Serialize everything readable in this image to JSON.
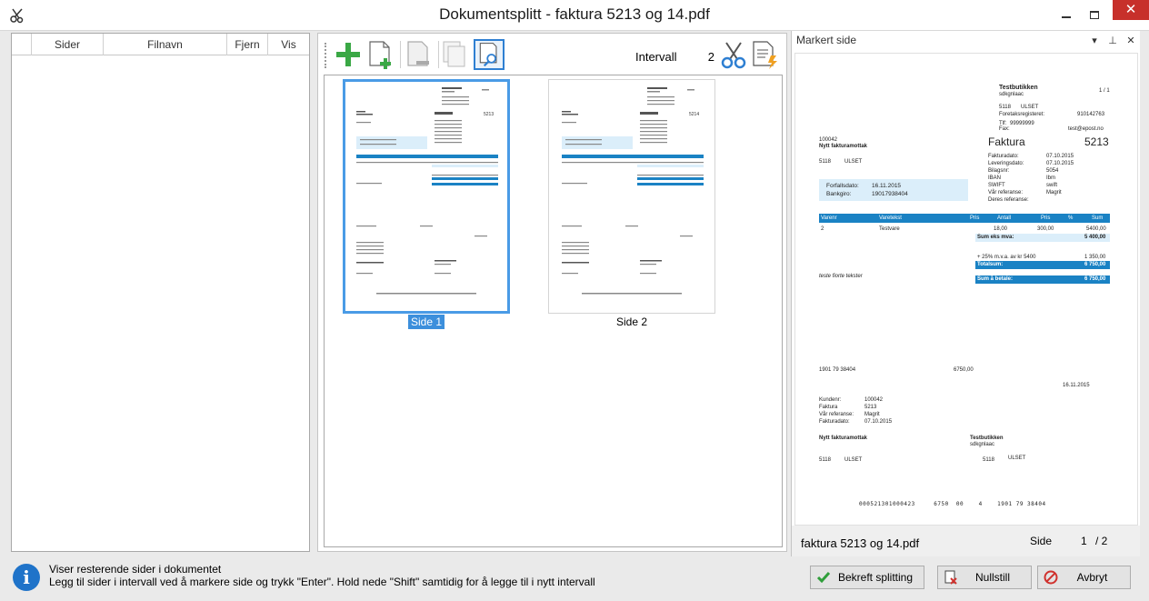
{
  "window": {
    "title": "Dokumentsplitt - faktura 5213 og 14.pdf",
    "minimize": "–",
    "maximize": "□",
    "close": "✕"
  },
  "list": {
    "columns": [
      "",
      "Sider",
      "Filnavn",
      "Fjern",
      "Vis"
    ]
  },
  "toolbar": {
    "interval_label": "Intervall",
    "interval_value": "2"
  },
  "thumbnails": [
    {
      "label": "Side 1",
      "selected": true,
      "invoice_no": "5213"
    },
    {
      "label": "Side 2",
      "selected": false,
      "invoice_no": "5214"
    }
  ],
  "preview": {
    "panel_title": "Markert side",
    "filename": "faktura 5213 og 14.pdf",
    "page_label": "Side",
    "page_current": "1",
    "page_total": "/ 2",
    "doc": {
      "seller_name": "Testbutikken",
      "seller_sub": "sdkgnlaac",
      "page_ratio": "1 / 1",
      "seller_zip": "5118",
      "seller_city": "ULSET",
      "org_label": "Foretaksregisteret:",
      "org_value": "910142763",
      "tlf_label": "Tlf:",
      "tlf_value": "99999999",
      "fax_label": "Fax:",
      "email": "test@epost.no",
      "customer_no": "100042",
      "customer_name": "Nytt fakturamottak",
      "title": "Faktura",
      "invoice_no": "5213",
      "cust_zip": "5118",
      "cust_city": "ULSET",
      "meta_labels": [
        "Fakturadato:",
        "Leveringsdato:",
        "Bilagsnr:",
        "IBAN",
        "SWIFT",
        "Vår referanse:",
        "Deres referanse:"
      ],
      "meta_values": [
        "07.10.2015",
        "07.10.2015",
        "5054",
        "Ibm",
        "swift",
        "Magrit",
        ""
      ],
      "due_label": "Forfallsdato:",
      "due_value": "16.11.2015",
      "bank_label": "Bankgiro:",
      "bank_value": "19017938404",
      "table_headers": [
        "Varenr",
        "Varetekst",
        "Pris",
        "Antall",
        "Pris",
        "%",
        "Sum"
      ],
      "row": [
        "2",
        "Testvare",
        "",
        "18,00",
        "300,00",
        "",
        "5400,00"
      ],
      "sum_ex_label": "Sum eks mva:",
      "sum_ex_value": "5 400,00",
      "vat_line": "+ 25% m.v.a. av kr 5400",
      "vat_value": "1 350,00",
      "total_label": "Totalsum:",
      "total_value": "6 750,00",
      "pay_label": "Sum å betale:",
      "pay_value": "6 750,00",
      "free_text": "teste fiorte tekster",
      "account_line": "1901 79 38404",
      "amount_line": "6750,00",
      "date_line": "16.11.2015",
      "slip_labels": [
        "Kundenr:",
        "Faktura",
        "Vår referanse:",
        "Fakturadato:"
      ],
      "slip_values": [
        "100042",
        "5213",
        "Magrit",
        "07.10.2015"
      ],
      "slip_payer": "Nytt fakturamottak",
      "slip_payee": "Testbutikken",
      "slip_payee_sub": "sdkgnlaac",
      "slip_payer_zip": "5118",
      "slip_payer_city": "ULSET",
      "slip_payee_zip": "5118",
      "slip_payee_city": "ULSET",
      "ocr_line": "000521301000423     6750  00    4    1901 79 38404"
    }
  },
  "status": {
    "line1": "Viser resterende sider i dokumentet",
    "line2": "Legg til sider i intervall ved å markere side og trykk \"Enter\". Hold nede \"Shift\" samtidig for å legge til i nytt intervall"
  },
  "buttons": {
    "confirm": "Bekreft splitting",
    "reset": "Nullstill",
    "cancel": "Avbryt"
  },
  "colors": {
    "accent": "#1a82c4",
    "selection": "#4a9be6",
    "close": "#c7302b"
  }
}
